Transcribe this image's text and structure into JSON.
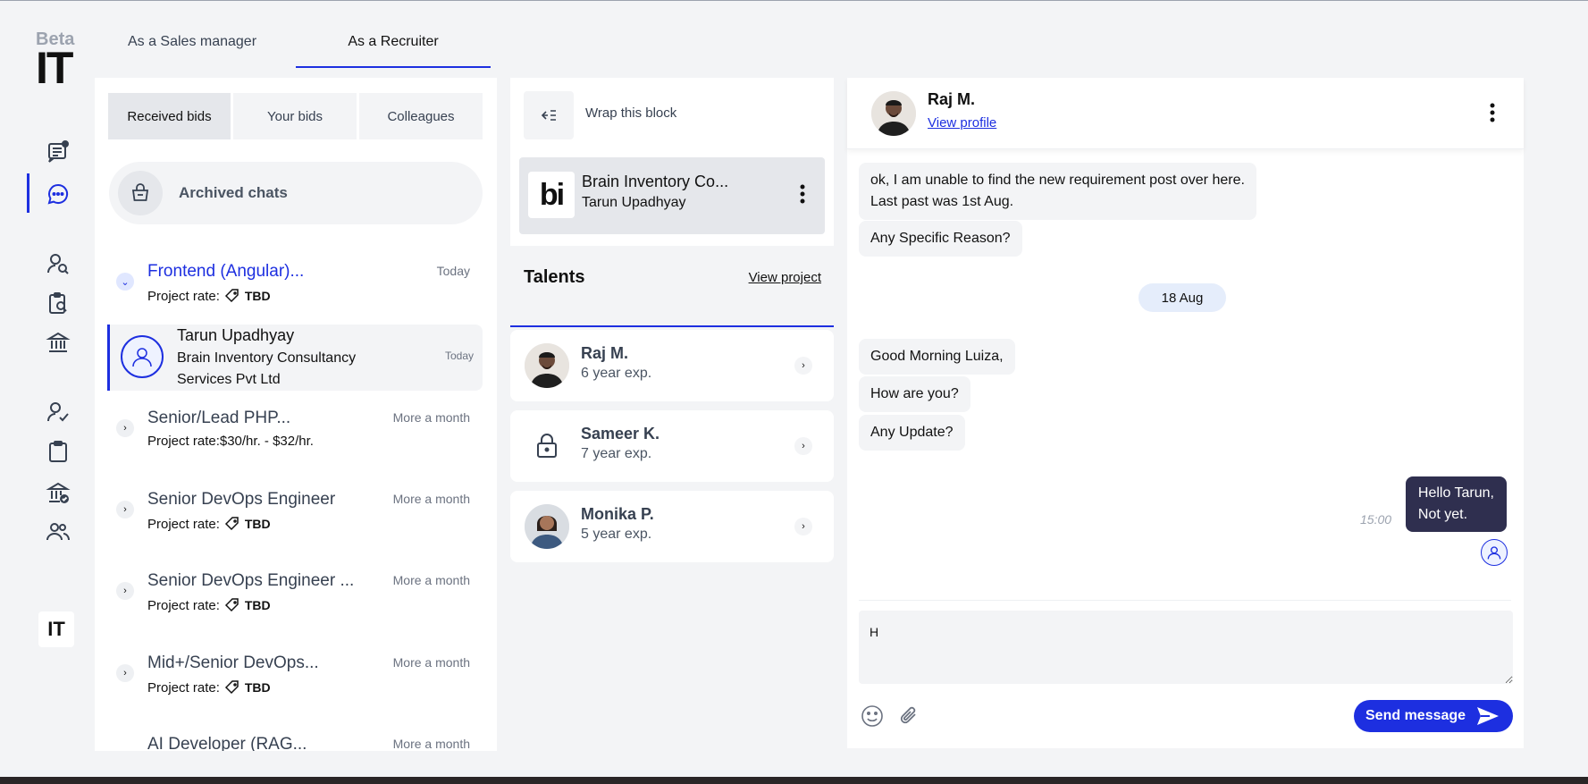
{
  "logo": {
    "beta": "Beta",
    "mark": "IT"
  },
  "top_tabs": [
    {
      "label": "As a Sales manager",
      "active": false
    },
    {
      "label": "As a Recruiter",
      "active": true
    }
  ],
  "sidebar": {
    "icons": [
      "posts-icon",
      "chat-icon",
      "search-person-icon",
      "clipboard-search-icon",
      "bank-icon",
      "person-check-icon",
      "clipboard-icon",
      "bank-check-icon",
      "people-icon"
    ],
    "active": "chat-icon",
    "bottom_mark": "IT"
  },
  "bids": {
    "segments": [
      "Received bids",
      "Your bids",
      "Colleagues"
    ],
    "active_segment": "Received bids",
    "archived_label": "Archived chats",
    "projects": [
      {
        "title": "Frontend (Angular)...",
        "when": "Today",
        "rate_label": "Project rate:",
        "rate_value": "TBD",
        "expanded": true
      },
      {
        "title": "Senior/Lead PHP...",
        "when": "More a month",
        "rate_label": "Project rate:$30/hr. - $32/hr.",
        "rate_value": ""
      },
      {
        "title": "Senior DevOps Engineer",
        "when": "More a month",
        "rate_label": "Project rate:",
        "rate_value": "TBD"
      },
      {
        "title": "Senior DevOps Engineer ...",
        "when": "More a month",
        "rate_label": "Project rate:",
        "rate_value": "TBD"
      },
      {
        "title": "Mid+/Senior DevOps...",
        "when": "More a month",
        "rate_label": "Project rate:",
        "rate_value": "TBD"
      },
      {
        "title": "AI Developer (RAG...",
        "when": "More a month"
      }
    ],
    "active_convo": {
      "name": "Tarun Upadhyay",
      "company": "Brain Inventory Consultancy Services Pvt Ltd",
      "when": "Today"
    }
  },
  "middle": {
    "wrap_label": "Wrap this block",
    "company": {
      "logo_text": "bi",
      "name": "Brain Inventory Co...",
      "person": "Tarun Upadhyay"
    },
    "talents_title": "Talents",
    "view_project": "View project",
    "talents": [
      {
        "name": "Raj M.",
        "exp": "6 year exp.",
        "locked": false
      },
      {
        "name": "Sameer K.",
        "exp": "7 year exp.",
        "locked": true
      },
      {
        "name": "Monika P.",
        "exp": "5 year exp.",
        "locked": false
      }
    ]
  },
  "chat": {
    "name": "Raj M.",
    "view_profile": "View profile",
    "messages": [
      {
        "text": "ok, I am unable to find the new requirement post over here.",
        "text2": "Last past was 1st Aug."
      },
      {
        "text": "Any Specific Reason?"
      },
      {
        "text": "Good Morning Luiza,"
      },
      {
        "text": "How are you?"
      },
      {
        "text": "Any Update?"
      }
    ],
    "date_pill": "18 Aug",
    "my_message": {
      "line1": "Hello Tarun,",
      "line2": "Not yet.",
      "time": "15:00"
    },
    "input_value": "H",
    "send_label": "Send message"
  }
}
